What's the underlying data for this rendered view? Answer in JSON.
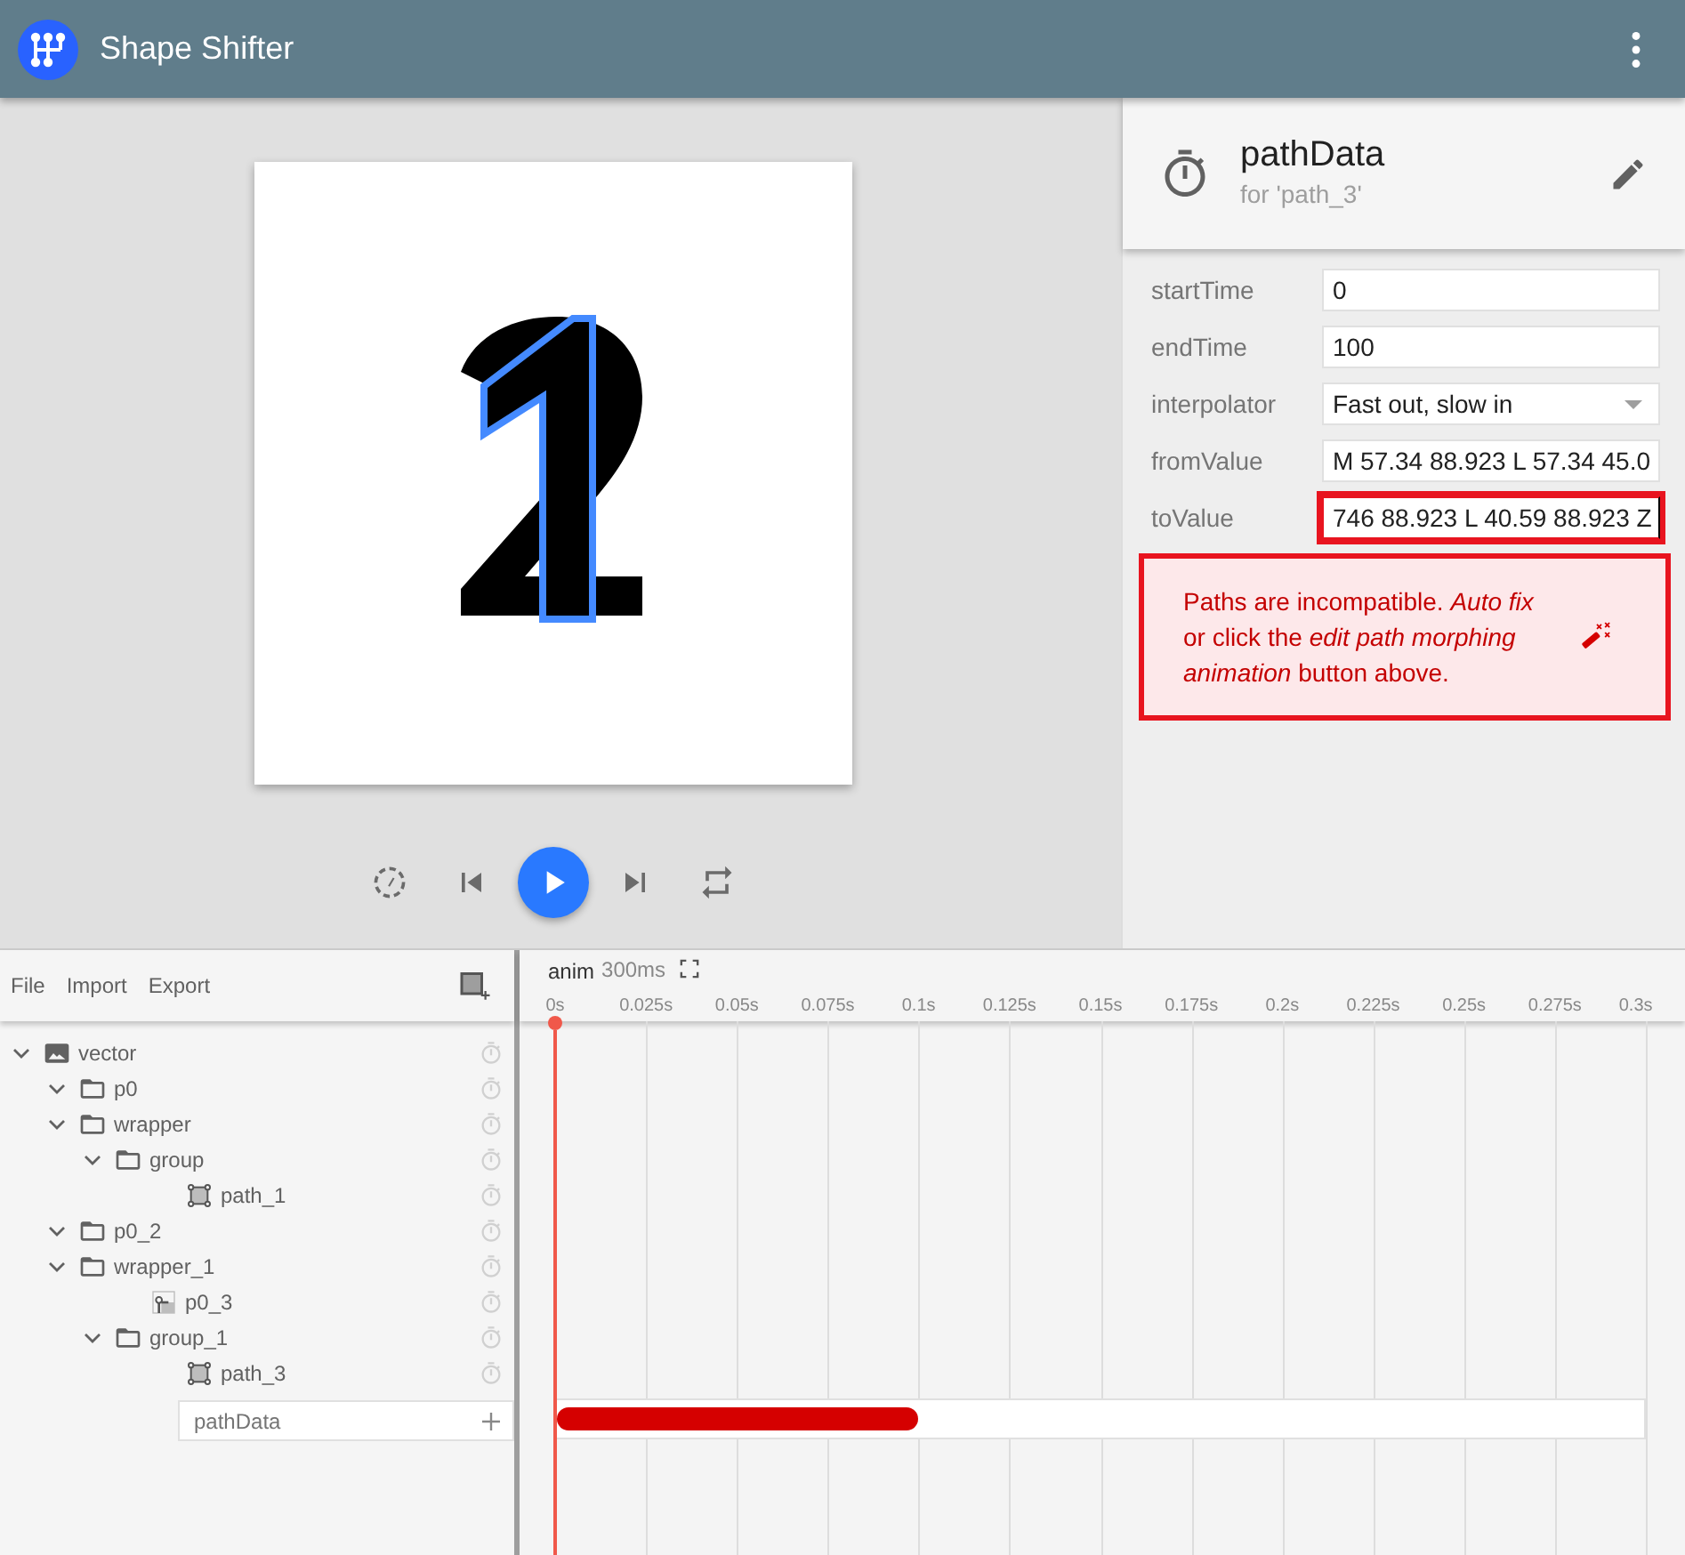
{
  "app_bar": {
    "title": "Shape Shifter"
  },
  "playback": {
    "playing": false
  },
  "inspector": {
    "title": "pathData",
    "subtitle": "for 'path_3'",
    "fields": [
      {
        "label": "startTime",
        "kind": "text",
        "value": "0",
        "invalid": false
      },
      {
        "label": "endTime",
        "kind": "text",
        "value": "100",
        "invalid": false
      },
      {
        "label": "interpolator",
        "kind": "select",
        "value": "Fast out, slow in",
        "invalid": false
      },
      {
        "label": "fromValue",
        "kind": "text",
        "value": "M 57.34 88.923 L 57.34 45.0",
        "invalid": false
      },
      {
        "label": "toValue",
        "kind": "text",
        "value": "746 88.923 L 40.59 88.923 Z",
        "invalid": true
      }
    ],
    "error_message": "Paths are incompatible. *Auto fix* or click the *edit path morphing animation* button above."
  },
  "layers": {
    "menu": [
      "File",
      "Import",
      "Export"
    ],
    "tree": [
      {
        "name": "vector",
        "kind": "vector",
        "expanded": true,
        "children": [
          {
            "name": "p0",
            "kind": "group",
            "expanded": true
          },
          {
            "name": "wrapper",
            "kind": "group",
            "expanded": true,
            "children": [
              {
                "name": "group",
                "kind": "group",
                "expanded": true,
                "children": [
                  {
                    "name": "path_1",
                    "kind": "path"
                  }
                ]
              }
            ]
          },
          {
            "name": "p0_2",
            "kind": "group",
            "expanded": true
          },
          {
            "name": "wrapper_1",
            "kind": "group",
            "expanded": true,
            "children": [
              {
                "name": "p0_3",
                "kind": "clip"
              },
              {
                "name": "group_1",
                "kind": "group",
                "expanded": true,
                "children": [
                  {
                    "name": "path_3",
                    "kind": "path",
                    "properties": [
                      "pathData"
                    ]
                  }
                ]
              }
            ]
          }
        ]
      }
    ]
  },
  "timeline": {
    "name": "anim",
    "duration": "300ms",
    "ticks": [
      "0s",
      "0.025s",
      "0.05s",
      "0.075s",
      "0.1s",
      "0.125s",
      "0.15s",
      "0.175s",
      "0.2s",
      "0.225s",
      "0.25s",
      "0.275s",
      "0.3s"
    ],
    "blocks": [
      {
        "level": 0.333
      }
    ]
  }
}
